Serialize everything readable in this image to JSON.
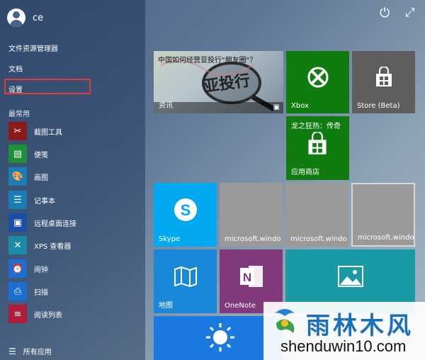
{
  "user": {
    "name": "ce"
  },
  "top_icons": {
    "power": "power-icon",
    "expand": "expand-icon"
  },
  "nav": {
    "file_explorer": "文件资源管理器",
    "documents": "文档",
    "settings": "设置"
  },
  "most_used": {
    "title": "最常用",
    "apps": [
      {
        "label": "截图工具",
        "icon": "scissors-icon",
        "color": "#8b1a1a"
      },
      {
        "label": "便笺",
        "icon": "sticky-note-icon",
        "color": "#1e8f3a"
      },
      {
        "label": "画图",
        "icon": "paint-icon",
        "color": "#1a7db5"
      },
      {
        "label": "记事本",
        "icon": "notepad-icon",
        "color": "#1a7db5"
      },
      {
        "label": "远程桌面连接",
        "icon": "remote-desktop-icon",
        "color": "#1a4fa3"
      },
      {
        "label": "XPS 查看器",
        "icon": "xps-icon",
        "color": "#1a8ca5"
      },
      {
        "label": "闹钟",
        "icon": "alarm-icon",
        "color": "#1a6fd0"
      },
      {
        "label": "扫描",
        "icon": "scanner-icon",
        "color": "#1a6fd0"
      },
      {
        "label": "阅读列表",
        "icon": "reading-list-icon",
        "color": "#b01c3a"
      }
    ]
  },
  "all_apps": "所有应用",
  "tiles": {
    "news": {
      "headline": "中国如何经营亚投行\"朋友圈\"？",
      "label": "资讯",
      "stamp": "亚投行"
    },
    "xbox": {
      "label": "Xbox",
      "color": "#107c10"
    },
    "store_beta": {
      "label": "Store (Beta)",
      "color": "#5e5e5e"
    },
    "store": {
      "label": "应用商店",
      "promo": "龙之狂热：传奇",
      "color": "#107c10"
    },
    "skype": {
      "label": "Skype",
      "color": "#00a9f0"
    },
    "ms1": {
      "label": "microsoft.windo"
    },
    "ms2": {
      "label": "microsoft.windo"
    },
    "ms3": {
      "label": "microsoft.windo"
    },
    "maps": {
      "label": "地图",
      "color": "#1a88d8"
    },
    "onenote": {
      "label": "OneNote",
      "color": "#80397b"
    },
    "photos": {
      "label": "",
      "color": "#1a9aa5"
    },
    "weather": {
      "color": "#1a7ae0"
    }
  },
  "watermark": {
    "brand": "雨林木风",
    "url": "shenduwin10.com"
  }
}
